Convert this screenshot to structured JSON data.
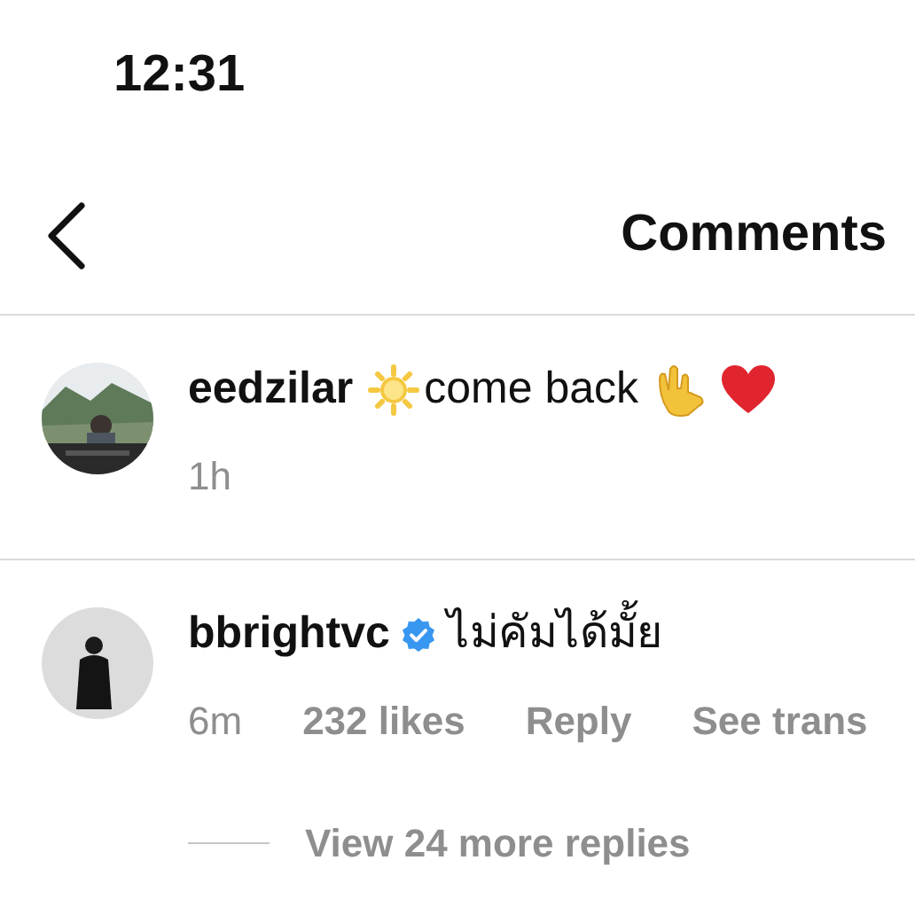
{
  "status_bar": {
    "time": "12:31"
  },
  "header": {
    "title": "Comments"
  },
  "comments": [
    {
      "username": "eedzilar",
      "verified": false,
      "text": "come back",
      "meta": [
        "1h"
      ]
    },
    {
      "username": "bbrightvc",
      "verified": true,
      "text": "ไม่คัมได้มั้ย",
      "meta": [
        "6m",
        "232 likes",
        "Reply",
        "See trans"
      ],
      "view_replies": "View 24 more replies"
    }
  ]
}
